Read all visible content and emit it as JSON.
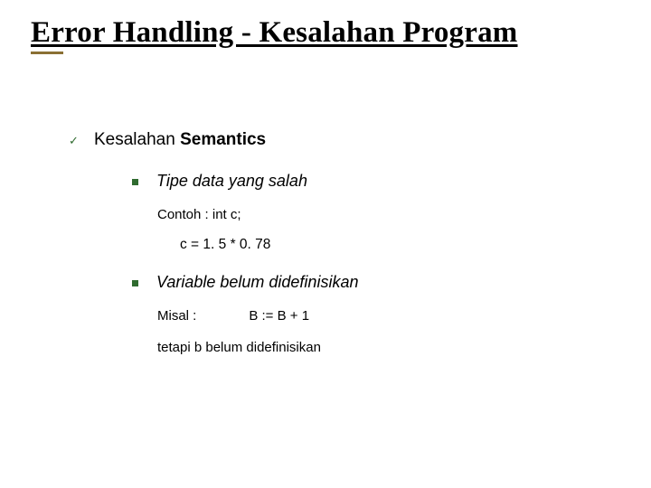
{
  "title": "Error Handling - Kesalahan Program",
  "bullet1": {
    "prefix": "Kesalahan ",
    "bold": "Semantics"
  },
  "sub1": "Tipe data yang salah",
  "example1_label": "Contoh : int c;",
  "example1_code": "c = 1. 5 * 0. 78",
  "sub2": "Variable belum didefinisikan",
  "misal_label": "Misal :",
  "misal_code": "B := B + 1",
  "note": "tetapi b belum didefinisikan"
}
